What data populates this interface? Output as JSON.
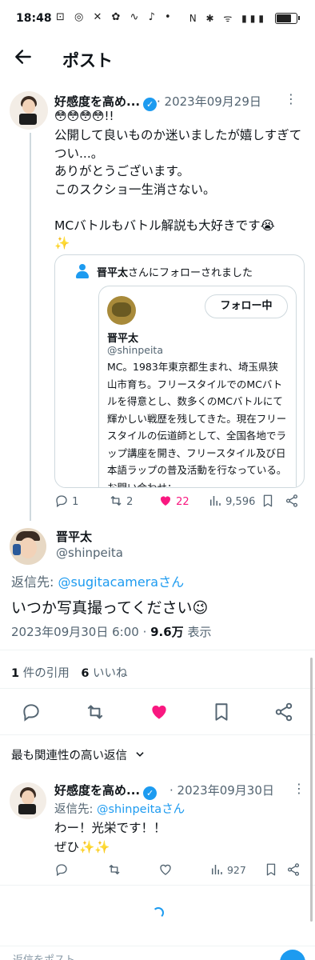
{
  "status_bar": {
    "time": "18:48",
    "left_icons": "⊡ ◎ ✕ ✿ ∿ ♪ •",
    "right_icons": "N ✱ ᯤ ▮▮▮",
    "battery_level_pct": 80
  },
  "header": {
    "back_icon": "arrow-left-icon",
    "title": "ポスト"
  },
  "post1": {
    "name": "好感度を高め...",
    "date": "2023年09月29日",
    "emojis": "😳😳😳😳!!",
    "body": "公開して良いものか迷いましたが嬉しすぎてつい...。\nありがとうございます。\nこのスクショ一生消さない。\n\nMCバトルもバトル解説も大好きです😭\n✨",
    "quote": {
      "notif_name": "晋平太",
      "notif_suffix": "さんにフォローされました",
      "follow_button": "フォロー中",
      "profile_name": "晋平太",
      "profile_handle": "@shinpeita",
      "profile_bio": "MC。1983年東京都生まれ、埼玉県狭山市育ち。フリースタイルでのMCバトルを得意とし、数多くのMCバトルにて輝かしい戦歴を残してきた。現在フリースタイルの伝道師として、全国各地でラップ講座を開き、フリースタイル及び日本語ラップの普及活動を行なっている。お問い合わせ："
    },
    "actions": {
      "replies": "1",
      "reposts": "2",
      "likes": "22",
      "views": "9,596"
    }
  },
  "post2": {
    "name": "晋平太",
    "handle": "@shinpeita",
    "reply_prefix": "返信先: ",
    "reply_link": "@sugitacamera",
    "reply_suffix": "さん",
    "body": "いつか写真撮ってください😉",
    "datetime": "2023年09月30日 6:00 · ",
    "views": "9.6万",
    "views_label": " 表示"
  },
  "stats": {
    "quotes_count": "1",
    "quotes_label": " 件の引用",
    "likes_count": "6",
    "likes_label": " いいね"
  },
  "sort_label": "最も関連性の高い返信",
  "post3": {
    "name": "好感度を高め...",
    "date": "2023年09月30日",
    "reply_prefix": "返信先: ",
    "reply_link": "@shinpeita",
    "reply_suffix": "さん",
    "body": "わー！光栄です！！\nぜひ✨✨",
    "views": "927"
  },
  "reply_bar": {
    "placeholder": "返信をポスト"
  },
  "colors": {
    "accent": "#1d9bf0",
    "like": "#f91880",
    "secondary_text": "#536471"
  }
}
